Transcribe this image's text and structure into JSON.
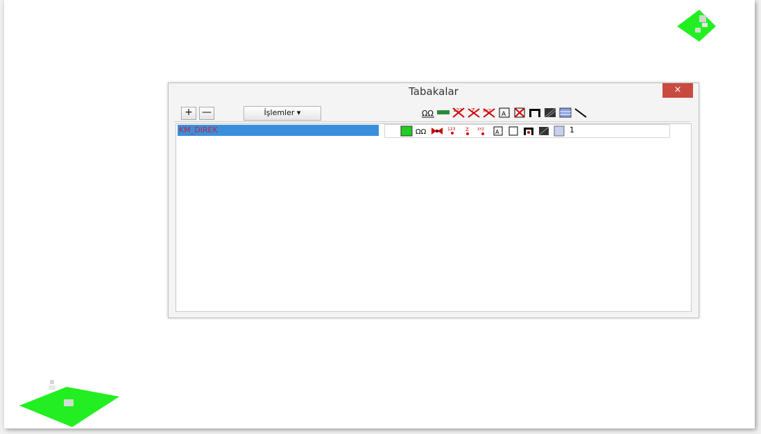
{
  "window": {
    "title": "Tabakalar",
    "close_glyph": "×"
  },
  "toolbar": {
    "add_glyph": "+",
    "remove_glyph": "—",
    "menu_label": "İşlemler ▾",
    "column_icons": [
      "visibility-icon",
      "key-icon",
      "numbering-icon",
      "elevation-icon",
      "coordinate-icon",
      "text-box-icon",
      "cross-box-icon",
      "table-icon",
      "pattern-icon",
      "hatch-icon",
      "line-icon"
    ]
  },
  "layers": [
    {
      "name": "KM_DIREK",
      "color": "#22cc22",
      "selected": true,
      "number": "1",
      "icons": [
        "visibility-icon",
        "lock-icon",
        "numbering-icon",
        "elevation-icon",
        "coordinate-icon",
        "text-box-icon",
        "empty-box-icon",
        "table-icon",
        "pattern-icon",
        "hatch-box-icon"
      ]
    }
  ],
  "canvas": {
    "background": "#ffffff",
    "marker_color": "#22ee22"
  }
}
